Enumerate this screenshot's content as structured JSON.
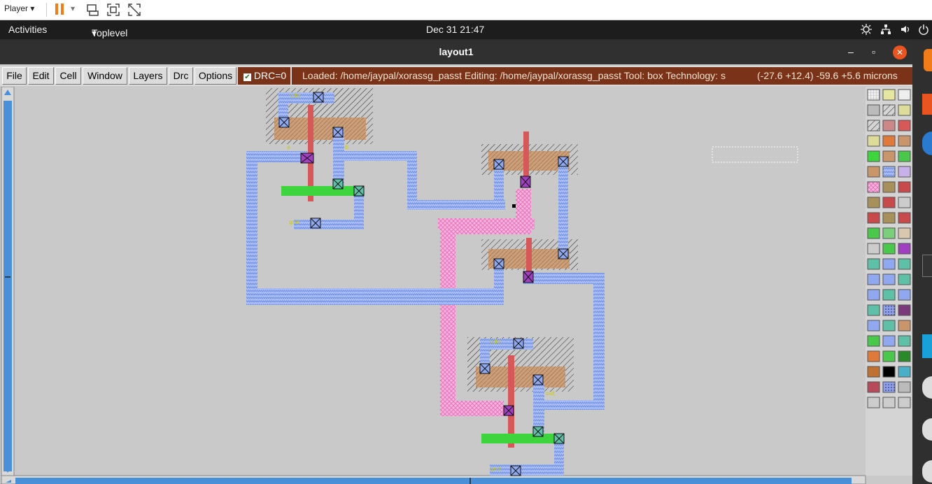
{
  "player": {
    "label": "Player",
    "dropdown": "▾"
  },
  "topbar": {
    "activities": "Activities",
    "app_menu": "Toplevel",
    "app_menu_arrow": "▾",
    "clock": "Dec 31  21:47"
  },
  "window": {
    "title": "layout1",
    "minimize": "–",
    "maximize": "▫",
    "close": "✕"
  },
  "menu": {
    "items": [
      "File",
      "Edit",
      "Cell",
      "Window",
      "Layers",
      "Drc",
      "Options"
    ]
  },
  "drc": {
    "label": "DRC=0",
    "check": "✔"
  },
  "status": {
    "loaded": "Loaded: /home/jaypal/xorassg_passt Editing: /home/jaypal/xorassg_passt Tool: box  Technology: s",
    "coords": "(-27.6 +12.4) -59.6 +5.6 microns"
  },
  "colors": {
    "metal1": "#8fa8f0",
    "poly": "#d75858",
    "ndiff": "#c9956a",
    "pdiff_pink": "#f09ad0",
    "green": "#3ed43e",
    "status_bg": "#7a3319",
    "canvas": "#c9c9c9"
  },
  "layout_labels": {
    "vdd": "vdd",
    "gnd": "gnd",
    "a": "a",
    "b": "b",
    "out": "out"
  }
}
